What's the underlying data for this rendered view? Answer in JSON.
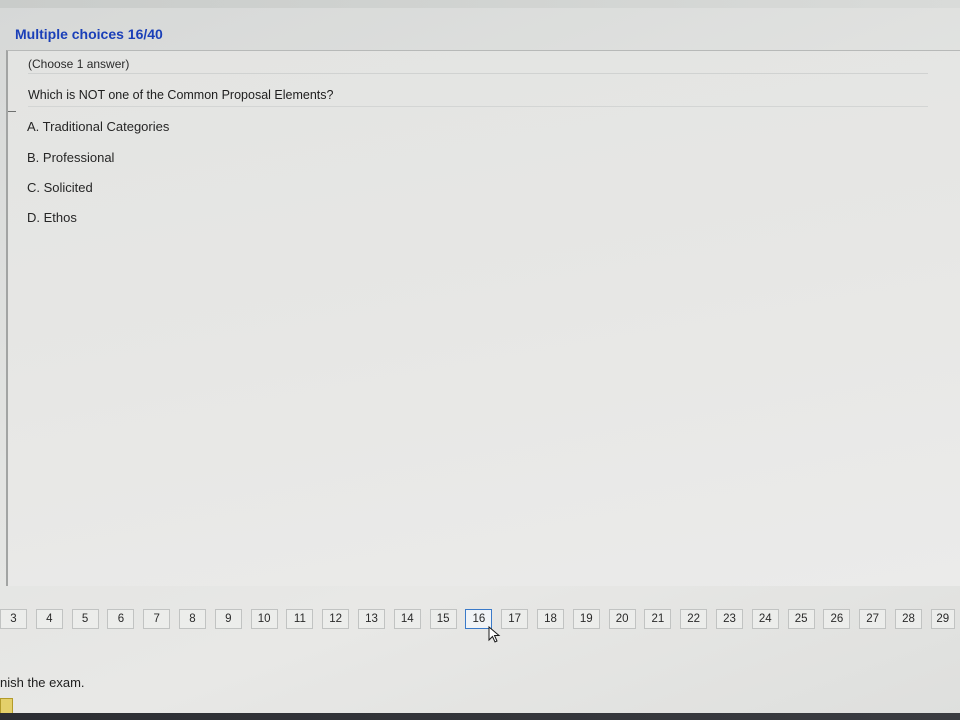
{
  "header": {
    "title": "Multiple choices 16/40"
  },
  "question": {
    "instruction": "(Choose 1 answer)",
    "text": "Which is NOT one of the Common Proposal Elements?",
    "options": [
      {
        "label": "A. Traditional Categories"
      },
      {
        "label": "B. Professional"
      },
      {
        "label": "C. Solicited"
      },
      {
        "label": "D. Ethos"
      }
    ]
  },
  "navigation": {
    "pages": [
      "3",
      "4",
      "5",
      "6",
      "7",
      "8",
      "9",
      "10",
      "11",
      "12",
      "13",
      "14",
      "15",
      "16",
      "17",
      "18",
      "19",
      "20",
      "21",
      "22",
      "23",
      "24",
      "25",
      "26",
      "27",
      "28",
      "29"
    ],
    "current_page": "16"
  },
  "footer": {
    "finish_label": "nish the exam."
  },
  "colors": {
    "title": "#1a3fb8",
    "current_border": "#3a7ac9",
    "flag": "#e4d06a"
  },
  "icons": {
    "cursor": "mouse-pointer-icon"
  }
}
